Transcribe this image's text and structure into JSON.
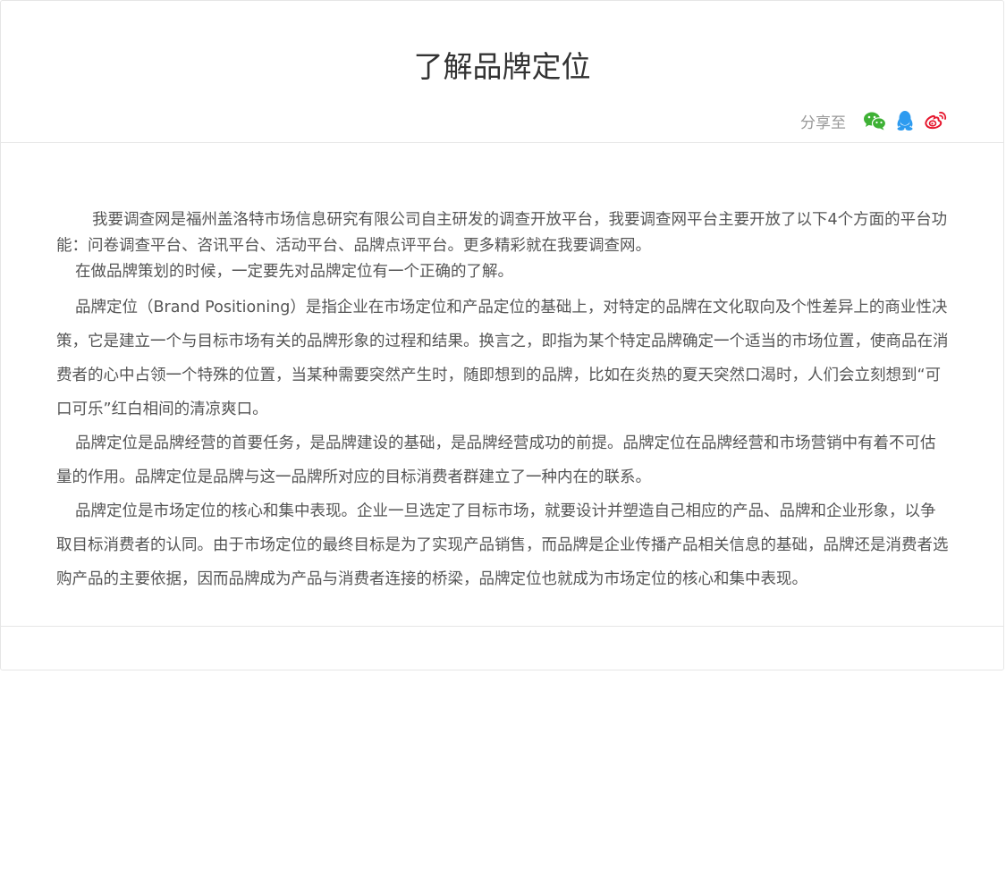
{
  "article": {
    "title": "了解品牌定位",
    "share": {
      "label": "分享至",
      "icons": [
        {
          "name": "wechat-icon",
          "color": "#3eb135"
        },
        {
          "name": "qq-icon",
          "color": "#2d9bf0"
        },
        {
          "name": "weibo-icon",
          "color": "#e6162d"
        }
      ]
    },
    "paragraphs": [
      "我要调查网是福州盖洛特市场信息研究有限公司自主研发的调查开放平台，我要调查网平台主要开放了以下4个方面的平台功能：问卷调查平台、咨讯平台、活动平台、品牌点评平台。更多精彩就在我要调查网。",
      "在做品牌策划的时候，一定要先对品牌定位有一个正确的了解。",
      "品牌定位（Brand Positioning）是指企业在市场定位和产品定位的基础上，对特定的品牌在文化取向及个性差异上的商业性决策，它是建立一个与目标市场有关的品牌形象的过程和结果。换言之，即指为某个特定品牌确定一个适当的市场位置，使商品在消费者的心中占领一个特殊的位置，当某种需要突然产生时，随即想到的品牌，比如在炎热的夏天突然口渴时，人们会立刻想到“可口可乐”红白相间的清凉爽口。",
      "品牌定位是品牌经营的首要任务，是品牌建设的基础，是品牌经营成功的前提。品牌定位在品牌经营和市场营销中有着不可估量的作用。品牌定位是品牌与这一品牌所对应的目标消费者群建立了一种内在的联系。",
      "品牌定位是市场定位的核心和集中表现。企业一旦选定了目标市场，就要设计并塑造自己相应的产品、品牌和企业形象，以争取目标消费者的认同。由于市场定位的最终目标是为了实现产品销售，而品牌是企业传播产品相关信息的基础，品牌还是消费者选购产品的主要依据，因而品牌成为产品与消费者连接的桥梁，品牌定位也就成为市场定位的核心和集中表现。"
    ]
  }
}
